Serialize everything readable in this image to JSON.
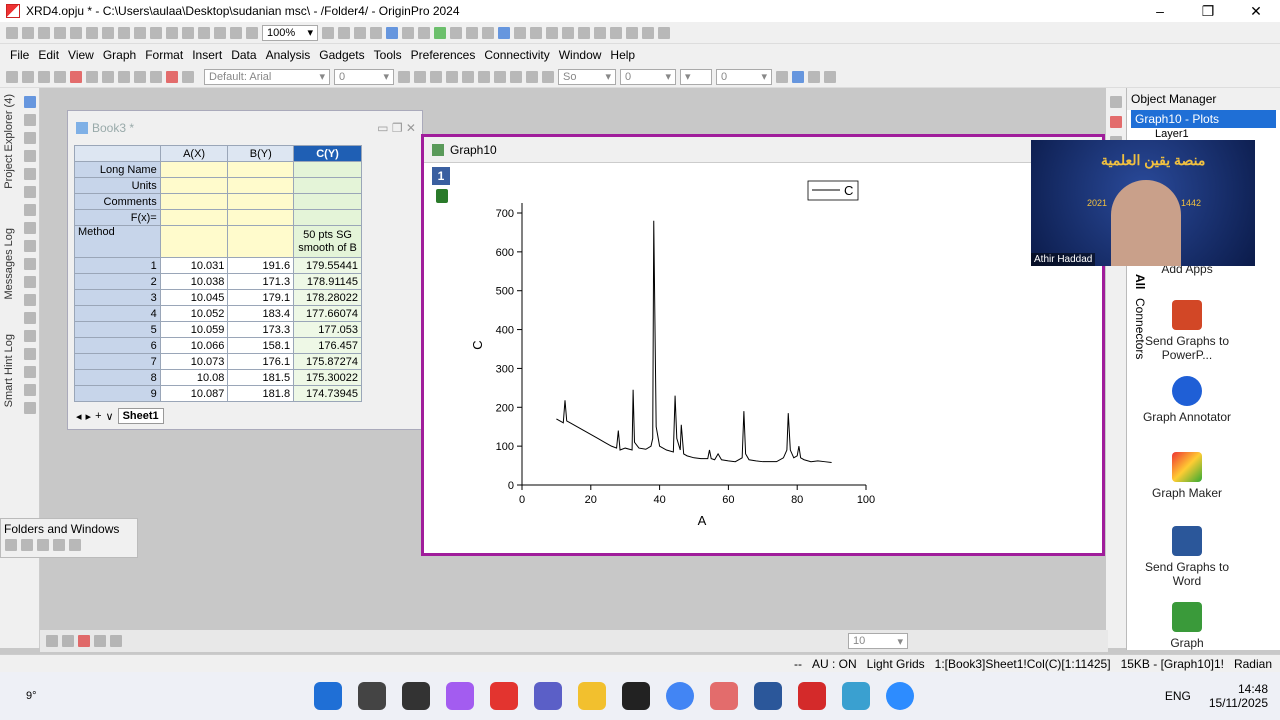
{
  "window": {
    "title": "XRD4.opju * - C:\\Users\\aulaa\\Desktop\\sudanian msc\\ - /Folder4/ - OriginPro 2024",
    "min": "–",
    "max": "❐",
    "close": "✕"
  },
  "menu": [
    "File",
    "Edit",
    "View",
    "Graph",
    "Format",
    "Insert",
    "Data",
    "Analysis",
    "Gadgets",
    "Tools",
    "Preferences",
    "Connectivity",
    "Window",
    "Help"
  ],
  "toolbar": {
    "zoom": "100%",
    "font": "Default: Arial",
    "font_size": "0",
    "line_style": "So",
    "line_width": "0",
    "other": "0",
    "pattern_size": "10"
  },
  "left_panel": {
    "project_explorer": "Project Explorer (4)",
    "messages_log": "Messages Log",
    "smart_hint_log": "Smart Hint Log"
  },
  "folders": {
    "title": "Folders and Windows"
  },
  "book": {
    "title": "Book3 *",
    "columns": [
      "A(X)",
      "B(Y)",
      "C(Y)"
    ],
    "row_labels": [
      "Long Name",
      "Units",
      "Comments",
      "F(x)=",
      "Method"
    ],
    "method_c": "50 pts SG smooth of B",
    "rows": [
      [
        "1",
        "10.031",
        "191.6",
        "179.55441"
      ],
      [
        "2",
        "10.038",
        "171.3",
        "178.91145"
      ],
      [
        "3",
        "10.045",
        "179.1",
        "178.28022"
      ],
      [
        "4",
        "10.052",
        "183.4",
        "177.66074"
      ],
      [
        "5",
        "10.059",
        "173.3",
        "177.053"
      ],
      [
        "6",
        "10.066",
        "158.1",
        "176.457"
      ],
      [
        "7",
        "10.073",
        "176.1",
        "175.87274"
      ],
      [
        "8",
        "10.08",
        "181.5",
        "175.30022"
      ],
      [
        "9",
        "10.087",
        "181.8",
        "174.73945"
      ]
    ],
    "sheet": "Sheet1"
  },
  "graph": {
    "title": "Graph10",
    "layer": "1"
  },
  "chart_data": {
    "type": "line",
    "xlabel": "A",
    "ylabel": "C",
    "xlim": [
      0,
      100
    ],
    "ylim": [
      0,
      700
    ],
    "xticks": [
      0,
      20,
      40,
      60,
      80,
      100
    ],
    "yticks": [
      0,
      100,
      200,
      300,
      400,
      500,
      600,
      700
    ],
    "legend": "C",
    "legend_position": "top-right",
    "series": [
      {
        "name": "C",
        "x": [
          10,
          12,
          12.5,
          13,
          14,
          16,
          18,
          20,
          22,
          24,
          26,
          27.5,
          28,
          28.5,
          30,
          32,
          32.3,
          32.7,
          34,
          36,
          37.5,
          38,
          38.3,
          39,
          40,
          42,
          44,
          44.5,
          45,
          46,
          46.3,
          47,
          48,
          50,
          52,
          54,
          54.5,
          55,
          56,
          57,
          58,
          60,
          62,
          64,
          64.5,
          65,
          66,
          68,
          70,
          72,
          74,
          76,
          77,
          77.4,
          78,
          79,
          80,
          80.5,
          81,
          82,
          84,
          86,
          88,
          90
        ],
        "y": [
          170,
          160,
          218,
          165,
          160,
          150,
          140,
          130,
          120,
          110,
          100,
          95,
          140,
          90,
          95,
          90,
          245,
          110,
          95,
          92,
          100,
          120,
          680,
          150,
          100,
          90,
          85,
          230,
          120,
          90,
          155,
          80,
          75,
          70,
          68,
          68,
          90,
          68,
          65,
          80,
          65,
          62,
          60,
          70,
          190,
          80,
          65,
          62,
          60,
          60,
          60,
          70,
          90,
          185,
          90,
          70,
          75,
          100,
          70,
          65,
          60,
          62,
          60,
          58
        ]
      }
    ]
  },
  "object_manager": {
    "title": "Object Manager",
    "item": "Graph10 - Plots",
    "layer": "Layer1"
  },
  "apps": {
    "all": "All",
    "connectors": "Connectors",
    "items": [
      "Add Apps",
      "Send Graphs to PowerP...",
      "Graph Annotator",
      "Graph Maker",
      "Send Graphs to Word",
      "Graph"
    ]
  },
  "webcam": {
    "name": "Athir Haddad",
    "caption": "منصة يقين العلمية",
    "year_l": "2021",
    "year_r": "1442"
  },
  "status": [
    "--",
    "AU : ON",
    "Light Grids",
    "1:[Book3]Sheet1!Col(C)[1:11425]",
    "15KB - [Graph10]1!",
    "Radian"
  ],
  "taskbar": {
    "weather": "9°",
    "lang": "ENG",
    "time": "14:48",
    "date": "15/11/2025"
  }
}
